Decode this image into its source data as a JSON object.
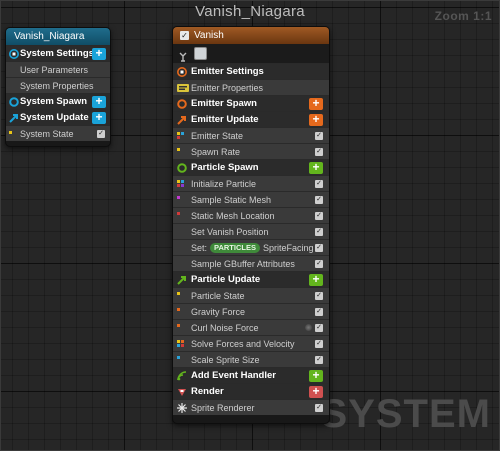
{
  "graph": {
    "title": "Vanish_Niagara",
    "zoom": "Zoom 1:1",
    "watermark": "SYSTEM"
  },
  "system_node": {
    "title": "Vanish_Niagara",
    "rows": [
      {
        "label": "System Settings",
        "kind": "section",
        "icon": "system-settings-icon",
        "add": true
      },
      {
        "label": "User Parameters",
        "kind": "item"
      },
      {
        "label": "System Properties",
        "kind": "item"
      },
      {
        "label": "System Spawn",
        "kind": "section",
        "icon": "system-spawn-icon",
        "add": true
      },
      {
        "label": "System Update",
        "kind": "section",
        "icon": "system-update-icon",
        "add": true
      },
      {
        "label": "System State",
        "kind": "item",
        "checked": true
      }
    ]
  },
  "emitter_node": {
    "title": "Vanish",
    "enabled": true,
    "sections": {
      "emitter_settings": "Emitter Settings",
      "emitter_properties": "Emitter Properties",
      "emitter_spawn": "Emitter Spawn",
      "emitter_update": "Emitter Update",
      "emitter_state": "Emitter State",
      "spawn_rate": "Spawn Rate",
      "particle_spawn": "Particle Spawn",
      "initialize_particle": "Initialize Particle",
      "sample_static_mesh": "Sample Static Mesh",
      "static_mesh_location": "Static Mesh Location",
      "set_vanish_position": "Set Vanish Position",
      "set_prefix": "Set:",
      "set_pill": "PARTICLES",
      "set_suffix": "SpriteFacing",
      "sample_gbuffer": "Sample GBuffer Attributes",
      "particle_update": "Particle Update",
      "particle_state": "Particle State",
      "gravity_force": "Gravity Force",
      "curl_noise_force": "Curl Noise Force",
      "solve_forces": "Solve Forces and Velocity",
      "scale_sprite_size": "Scale Sprite Size",
      "add_event_handler": "Add Event Handler",
      "render": "Render",
      "sprite_renderer": "Sprite Renderer"
    }
  },
  "colors": {
    "system_header": "#1f6d8c",
    "emitter_header": "#a05a24",
    "add_blue": "#1aa3d9",
    "add_orange": "#e5691d",
    "add_green": "#63b51d",
    "add_red": "#d05050"
  }
}
